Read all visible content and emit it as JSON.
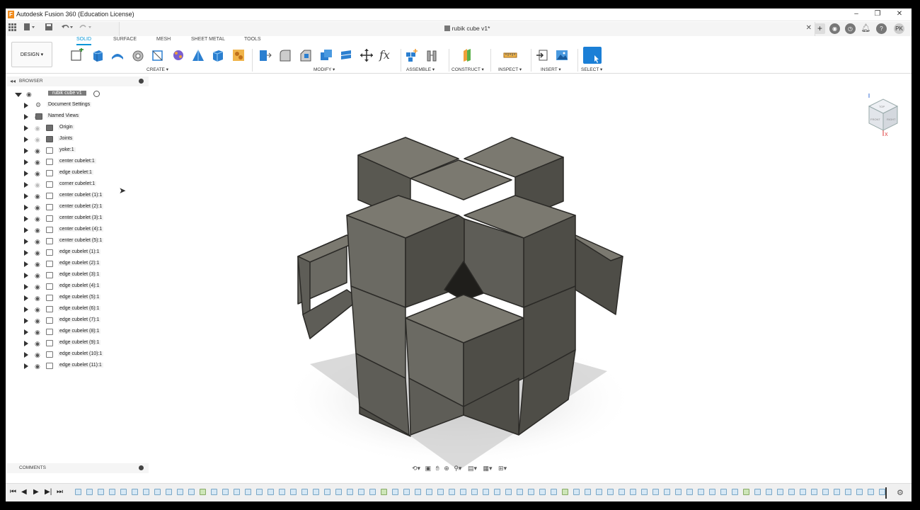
{
  "window": {
    "title": "Autodesk Fusion 360 (Education License)",
    "logo_letter": "F",
    "buttons": [
      "–",
      "❐",
      "✕"
    ]
  },
  "document": {
    "name": "rubik cube v1*",
    "close": "✕"
  },
  "user": {
    "initials": "PK"
  },
  "workspace": {
    "label": "DESIGN ▾"
  },
  "ribbon": {
    "tabs": [
      "SOLID",
      "SURFACE",
      "MESH",
      "SHEET METAL",
      "TOOLS"
    ],
    "active_tab": "SOLID",
    "groups": [
      "CREATE ▾",
      "MODIFY ▾",
      "ASSEMBLE ▾",
      "CONSTRUCT ▾",
      "INSPECT ▾",
      "INSERT ▾",
      "SELECT ▾"
    ]
  },
  "browser": {
    "title": "BROWSER",
    "root": "rubik cube v1",
    "items": [
      {
        "label": "Document Settings",
        "icon": "gear-icon"
      },
      {
        "label": "Named Views",
        "icon": "folder-icon"
      },
      {
        "label": "Origin",
        "icon": "folder-icon"
      },
      {
        "label": "Joints",
        "icon": "folder-icon"
      },
      {
        "label": "yoke:1",
        "icon": "component-icon"
      },
      {
        "label": "center cubelet:1",
        "icon": "component-icon"
      },
      {
        "label": "edge cubelet:1",
        "icon": "component-icon"
      },
      {
        "label": "corner cubelet:1",
        "icon": "component-icon"
      },
      {
        "label": "center cubelet (1):1",
        "icon": "component-icon"
      },
      {
        "label": "center cubelet (2):1",
        "icon": "component-icon"
      },
      {
        "label": "center cubelet (3):1",
        "icon": "component-icon"
      },
      {
        "label": "center cubelet (4):1",
        "icon": "component-icon"
      },
      {
        "label": "center cubelet (5):1",
        "icon": "component-icon"
      },
      {
        "label": "edge cubelet (1):1",
        "icon": "component-icon"
      },
      {
        "label": "edge cubelet (2):1",
        "icon": "component-icon"
      },
      {
        "label": "edge cubelet (3):1",
        "icon": "component-icon"
      },
      {
        "label": "edge cubelet (4):1",
        "icon": "component-icon"
      },
      {
        "label": "edge cubelet (5):1",
        "icon": "component-icon"
      },
      {
        "label": "edge cubelet (6):1",
        "icon": "component-icon"
      },
      {
        "label": "edge cubelet (7):1",
        "icon": "component-icon"
      },
      {
        "label": "edge cubelet (8):1",
        "icon": "component-icon"
      },
      {
        "label": "edge cubelet (9):1",
        "icon": "component-icon"
      },
      {
        "label": "edge cubelet (10):1",
        "icon": "component-icon"
      },
      {
        "label": "edge cubelet (11):1",
        "icon": "component-icon"
      }
    ]
  },
  "comments": {
    "title": "COMMENTS"
  },
  "viewcube": {
    "faces": [
      "TOP",
      "FRONT",
      "RIGHT"
    ]
  },
  "colors": {
    "accent": "#0696d7",
    "model": "#6b6a64",
    "select": "#1b7fd6"
  }
}
